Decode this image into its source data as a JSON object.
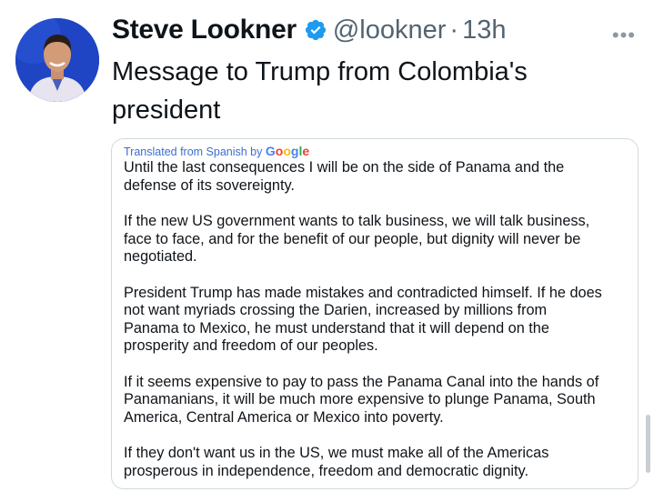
{
  "author": {
    "name": "Steve Lookner",
    "handle": "@lookner",
    "separator": "·",
    "time": "13h"
  },
  "more_menu": "•••",
  "tweet": {
    "text": "Message to Trump from Colombia's president"
  },
  "quote": {
    "translated_prefix": "Translated from Spanish by ",
    "translated_by": "Google",
    "paragraphs": [
      "Until the last consequences I will be on the side of Panama and the\ndefense of its sovereignty.",
      "If the new US government wants to talk business, we will talk business,\nface to face, and for the benefit of our people, but dignity will never be\nnegotiated.",
      "President Trump has made mistakes and contradicted himself. If he does\nnot want myriads crossing the Darien, increased by millions from\nPanama to Mexico, he must understand that it will depend on the\nprosperity and freedom of our peoples.",
      "If it seems expensive to pay to pass the Panama Canal into the hands of\nPanamanians, it will be much more expensive to plunge Panama, South\nAmerica, Central America or Mexico into poverty.",
      "If they don't want us in the US, we must make all of the Americas\nprosperous in independence, freedom and democratic dignity."
    ]
  },
  "colors": {
    "verified": "#1d9bf0",
    "secondary_text": "#536471",
    "border": "#cfd9de"
  }
}
